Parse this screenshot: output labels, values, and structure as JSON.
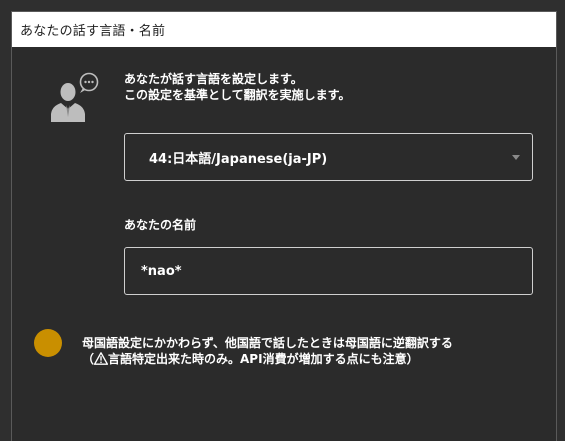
{
  "window": {
    "title": "あなたの話す言語・名前"
  },
  "language": {
    "description_line1": "あなたが話す言語を設定します。",
    "description_line2": "この設定を基準として翻訳を実施します。",
    "selected": "44:日本語/Japanese(ja-JP)"
  },
  "name": {
    "label": "あなたの名前",
    "value": "*nao*"
  },
  "back_translate": {
    "line1": "母国語設定にかかわらず、他国語で話したときは母国語に逆翻訳する",
    "line2_prefix": "（",
    "line2_text": "言語特定出来た時のみ。API消費が増加する点にも注意）"
  },
  "colors": {
    "toggle": "#c98f00",
    "background": "#2b2b2b",
    "border": "#cfcfcf"
  }
}
